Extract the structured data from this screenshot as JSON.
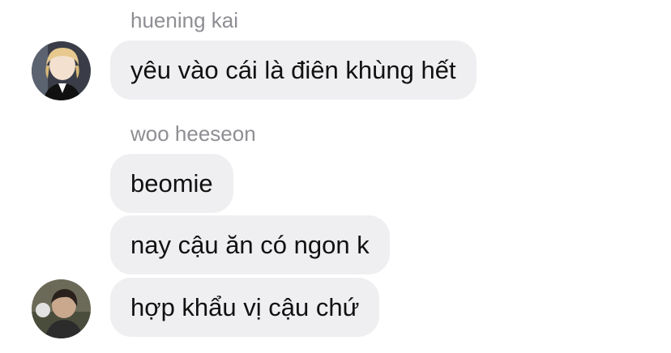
{
  "groups": [
    {
      "sender": "huening kai",
      "avatar_icon": "user-avatar-blonde",
      "messages": [
        "yêu vào cái là điên khùng hết"
      ]
    },
    {
      "sender": "woo heeseon",
      "avatar_icon": "user-avatar-dark",
      "messages": [
        "beomie",
        "nay cậu ăn có ngon k",
        "hợp khẩu vị cậu chứ"
      ]
    }
  ],
  "colors": {
    "bubble_bg": "#efeff1",
    "sender_text": "#8e8e93",
    "message_text": "#111111"
  }
}
